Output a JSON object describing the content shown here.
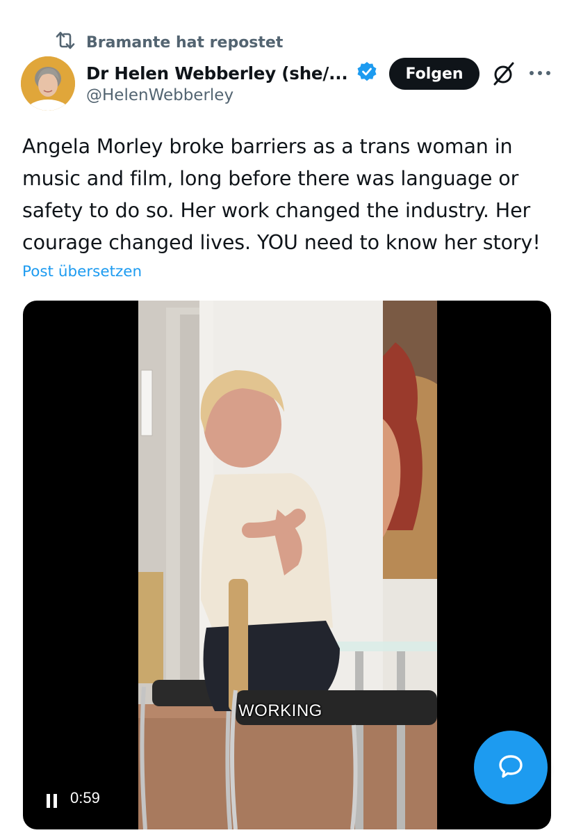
{
  "repost": {
    "label": "Bramante hat repostet"
  },
  "author": {
    "display_name": "Dr Helen Webberley (she/...",
    "handle": "@HelenWebberley",
    "verified": true
  },
  "actions": {
    "follow_label": "Folgen"
  },
  "tweet": {
    "text": "Angela Morley broke barriers as a trans woman in music and film, long before there was language or safety to do so. Her work changed the industry. Her courage changed lives. YOU need to know her story!",
    "translate_label": "Post übersetzen"
  },
  "video": {
    "caption": "WORKING",
    "time": "0:59",
    "state": "playing"
  },
  "icons": {
    "repost": "repost-icon",
    "verified": "verified-badge-icon",
    "grok": "grok-icon",
    "more": "more-icon",
    "pause": "pause-icon",
    "compose": "chat-bubble-icon"
  },
  "colors": {
    "accent": "#1d9bf0",
    "text": "#0f1419",
    "secondary": "#536471",
    "button_bg": "#0f1419"
  }
}
